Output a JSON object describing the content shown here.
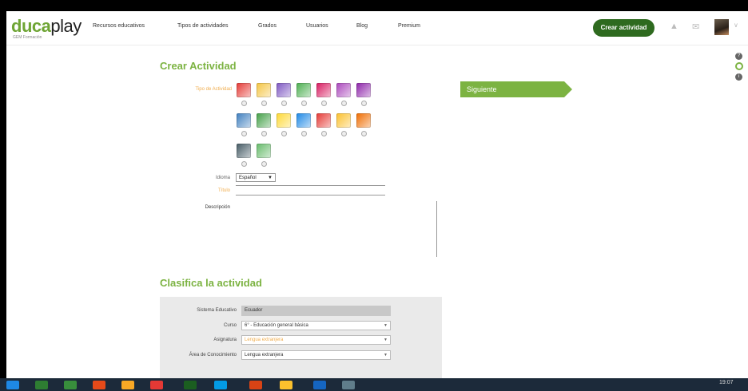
{
  "brand": {
    "logo_part1": "duca",
    "logo_part2": "play",
    "logo_sub": "GEM Formación"
  },
  "nav": {
    "items": [
      "Recursos educativos",
      "Tipos de actividades",
      "Grados",
      "Usuarios",
      "Blog",
      "Premium"
    ]
  },
  "header": {
    "create_label": "Crear actividad",
    "bell_icon": "bell-icon",
    "mail_icon": "mail-icon",
    "chevron_icon": "chevron-down-icon"
  },
  "form": {
    "title": "Crear Actividad",
    "type_label": "Tipo de Actividad",
    "icon_rows": [
      [
        "#e53935",
        "#f4c542",
        "#7e57c2",
        "#4caf50",
        "#d81b60",
        "#ab47bc",
        "#8e24aa"
      ],
      [
        "#3f7fbf",
        "#43a047",
        "#fdd835",
        "#1e88e5",
        "#e53935",
        "#fbc02d",
        "#ef6c00"
      ],
      [
        "#455a64",
        "#66bb6a"
      ]
    ],
    "language_label": "Idioma",
    "language_value": "Español",
    "title_label": "Título",
    "description_label": "Descripción"
  },
  "next_button": {
    "label": "Siguiente"
  },
  "classify": {
    "title": "Clasifica la actividad",
    "system_label": "Sistema Educativo",
    "system_value": "Ecuador",
    "course_label": "Curso",
    "course_value": "6° - Educación general básica",
    "subject_label": "Asignatura",
    "subject_value": "Lengua extranjera",
    "area_label": "Área de Conocimiento",
    "area_value": "Lengua extranjera"
  },
  "taskbar": {
    "apps": [
      "#1e88e5",
      "#2e7d32",
      "#388e3c",
      "#e64a19",
      "#f9a825",
      "#e53935",
      "#1b5e20",
      "#039be5",
      "#d84315",
      "#fbc02d",
      "#1565c0",
      "#607d8b"
    ],
    "clock": "19:07"
  }
}
